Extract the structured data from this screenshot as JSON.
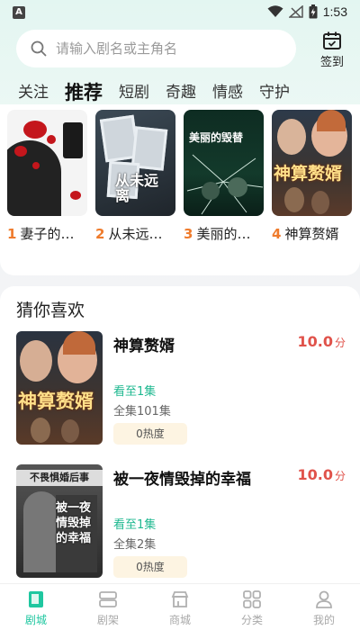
{
  "status_bar": {
    "left_badge": "A",
    "time": "1:53"
  },
  "search": {
    "placeholder": "请输入剧名或主角名"
  },
  "checkin": {
    "label": "签到"
  },
  "tabs": [
    {
      "label": "关注"
    },
    {
      "label": "推荐"
    },
    {
      "label": "短剧"
    },
    {
      "label": "奇趣"
    },
    {
      "label": "情感"
    },
    {
      "label": "守护"
    }
  ],
  "active_tab": "推荐",
  "featured": [
    {
      "rank": "1",
      "title": "妻子的…"
    },
    {
      "rank": "2",
      "title": "从未远…"
    },
    {
      "rank": "3",
      "title": "美丽的…"
    },
    {
      "rank": "4",
      "title": "神算赘婿"
    }
  ],
  "posters": {
    "p2_title": "从未远离",
    "p3_title": "美丽的毁替",
    "p4_title": "神算赘婿",
    "r2_band": "不畏惧婚后事",
    "r2_title": "被一夜情毁掉的幸福"
  },
  "recommendations": {
    "title": "猜你喜欢",
    "items": [
      {
        "name": "神算赘婿",
        "score": "10.0",
        "score_unit": "分",
        "progress": "看至1集",
        "total": "全集101集",
        "heat": "0热度"
      },
      {
        "name": "被一夜情毁掉的幸福",
        "score": "10.0",
        "score_unit": "分",
        "progress": "看至1集",
        "total": "全集2集",
        "heat": "0热度"
      }
    ]
  },
  "bottom_nav": [
    {
      "label": "剧城",
      "icon": "book-icon",
      "active": true
    },
    {
      "label": "剧架",
      "icon": "shelf-icon",
      "active": false
    },
    {
      "label": "商城",
      "icon": "store-icon",
      "active": false
    },
    {
      "label": "分类",
      "icon": "grid-icon",
      "active": false
    },
    {
      "label": "我的",
      "icon": "user-icon",
      "active": false
    }
  ],
  "colors": {
    "accent": "#1fc7a0",
    "rank": "#ef7b2c",
    "score": "#e0524a"
  }
}
